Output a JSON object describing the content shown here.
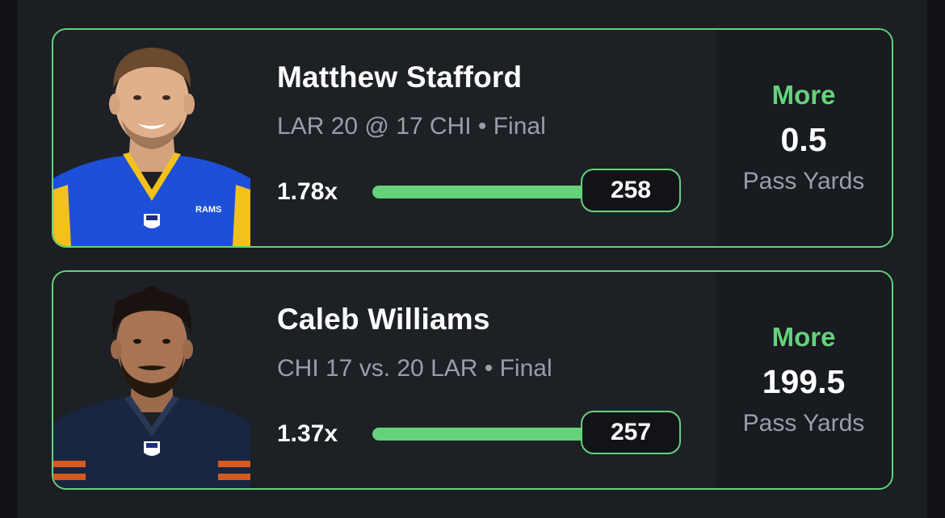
{
  "colors": {
    "accent_green": "#65d27b",
    "card_background": "#1d2025",
    "page_background": "#1b1e23",
    "muted_text": "#9a9ea6",
    "rams_blue": "#1d4fd8",
    "rams_gold": "#f2c21b",
    "bears_navy": "#1a2640",
    "bears_orange": "#d65a1e"
  },
  "cards": [
    {
      "player_name": "Matthew Stafford",
      "game_info": "LAR 20 @ 17 CHI • Final",
      "multiplier": "1.78x",
      "result_value": "258",
      "progress": 1.0,
      "pick": "More",
      "line": "0.5",
      "stat_type": "Pass Yards",
      "jersey_icon": "rams-jersey-icon",
      "jersey_text": "RAMS"
    },
    {
      "player_name": "Caleb Williams",
      "game_info": "CHI 17 vs. 20 LAR • Final",
      "multiplier": "1.37x",
      "result_value": "257",
      "progress": 1.0,
      "pick": "More",
      "line": "199.5",
      "stat_type": "Pass Yards",
      "jersey_icon": "bears-jersey-icon"
    }
  ]
}
